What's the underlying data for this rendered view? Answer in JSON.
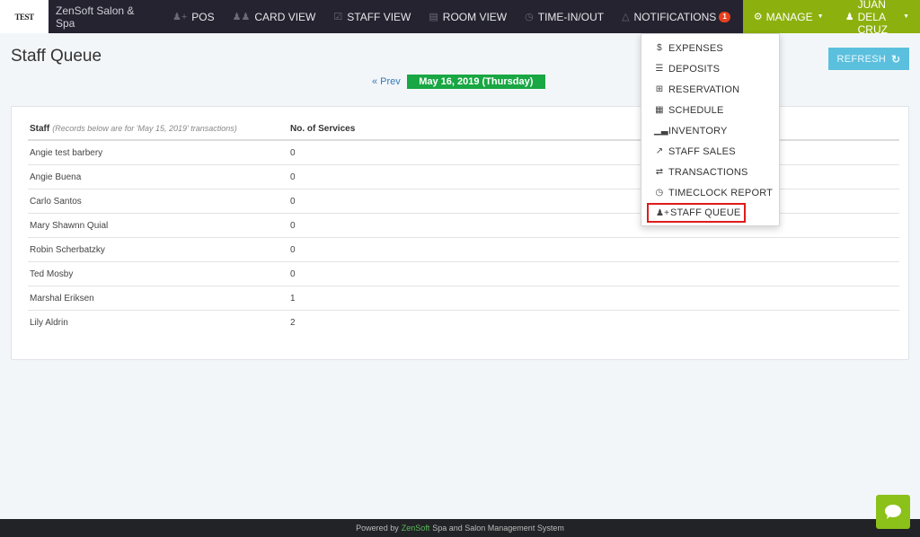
{
  "navbar": {
    "logo_text": "TEST",
    "brand_name": "ZenSoft Salon & Spa",
    "items": [
      {
        "label": "POS",
        "icon": "user-plus-icon"
      },
      {
        "label": "CARD VIEW",
        "icon": "users-icon"
      },
      {
        "label": "STAFF VIEW",
        "icon": "calendar-check-icon"
      },
      {
        "label": "ROOM VIEW",
        "icon": "bed-icon"
      },
      {
        "label": "TIME-IN/OUT",
        "icon": "clock-icon"
      },
      {
        "label": "NOTIFICATIONS",
        "icon": "bell-icon",
        "badge": "1"
      }
    ],
    "manage_label": "MANAGE",
    "user_label": "JUAN DELA CRUZ",
    "accent_color": "#8cb00d"
  },
  "manage_menu": {
    "items": [
      {
        "label": "EXPENSES",
        "icon": "dollar-icon"
      },
      {
        "label": "DEPOSITS",
        "icon": "list-icon"
      },
      {
        "label": "RESERVATION",
        "icon": "calendar-plus-icon"
      },
      {
        "label": "SCHEDULE",
        "icon": "calendar-icon"
      },
      {
        "label": "INVENTORY",
        "icon": "bar-chart-icon"
      },
      {
        "label": "STAFF SALES",
        "icon": "line-chart-icon"
      },
      {
        "label": "TRANSACTIONS",
        "icon": "exchange-icon"
      },
      {
        "label": "TIMECLOCK REPORT",
        "icon": "clock-icon"
      },
      {
        "label": "STAFF QUEUE",
        "icon": "user-plus-icon",
        "active": true
      }
    ]
  },
  "page": {
    "title": "Staff Queue",
    "prev_label": "« Prev",
    "current_date": "May 16, 2019 (Thursday)",
    "refresh_label": "REFRESH"
  },
  "table": {
    "col_staff": "Staff",
    "col_staff_note": "(Records below are for 'May 15, 2019' transactions)",
    "col_services": "No. of Services",
    "rows": [
      {
        "staff": "Angie test barbery",
        "services": "0"
      },
      {
        "staff": "Angie Buena",
        "services": "0"
      },
      {
        "staff": "Carlo Santos",
        "services": "0"
      },
      {
        "staff": "Mary Shawnn Quial",
        "services": "0"
      },
      {
        "staff": "Robin Scherbatzky",
        "services": "0"
      },
      {
        "staff": "Ted Mosby",
        "services": "0"
      },
      {
        "staff": "Marshal Eriksen",
        "services": "1"
      },
      {
        "staff": "Lily Aldrin",
        "services": "2"
      }
    ]
  },
  "footer": {
    "prefix": "Powered by",
    "brand": "ZenSoft",
    "suffix": "Spa and Salon Management System"
  }
}
